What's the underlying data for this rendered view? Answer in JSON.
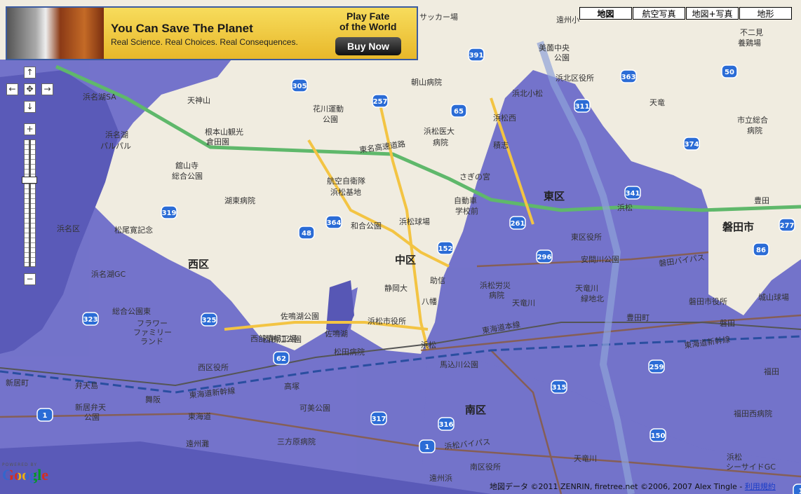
{
  "ad": {
    "headline": "You Can Save The Planet",
    "subline": "Real Science. Real Choices. Real Consequences.",
    "right_line1": "Play Fate",
    "right_line2": "of the World",
    "button": "Buy Now"
  },
  "map_types": [
    "地図",
    "航空写真",
    "地図+写真",
    "地形"
  ],
  "active_map_type": "地図",
  "controls": {
    "up": "↑",
    "down": "↓",
    "left": "←",
    "right": "→",
    "center": "✥",
    "zoom_in": "+",
    "zoom_out": "−"
  },
  "districts": [
    "西区",
    "中区",
    "東区",
    "南区",
    "磐田市"
  ],
  "places": [
    "天神山",
    "根本山観光",
    "倉田園",
    "舘山寺",
    "総合公園",
    "湖東病院",
    "浜名湖",
    "パルパル",
    "浜名区",
    "松尾寛記念",
    "浜名湖GC",
    "総合公園東",
    "フラワー",
    "ファミリー",
    "ランド",
    "西区役所",
    "西部清掃工場",
    "新居町",
    "弁天島",
    "新居弁天",
    "公園",
    "舞阪",
    "東海道",
    "可美公園",
    "三方原病院",
    "遠州灘",
    "佐鳴湖公園",
    "佐鳴湖",
    "西鴨江公園",
    "航空自衛隊",
    "浜松基地",
    "和合公園",
    "浜松球場",
    "花川運動",
    "公園",
    "朝山病院",
    "浜松医大",
    "病院",
    "自動車",
    "学校前",
    "静岡大",
    "浜松市役所",
    "浜松",
    "助信",
    "八幡",
    "松田病院",
    "高塚",
    "馬込川公園",
    "浜松労災",
    "病院",
    "天竜川",
    "安間川公園",
    "東区役所",
    "天竜川",
    "緑地北",
    "豊田町",
    "磐田",
    "磐田市役所",
    "城山球場",
    "浜北区役所",
    "浜北小松",
    "美薗中央",
    "公園",
    "天竜",
    "市立総合",
    "病院",
    "不二見",
    "養鶏場",
    "サッカー場",
    "遠州小",
    "浜松西",
    "さぎの宮",
    "積志",
    "浜松",
    "浜名湖SA",
    "南区",
    "南区役所",
    "遠州浜",
    "浜松",
    "シーサイドGC",
    "福田西病院",
    "福田",
    "東名高速道路",
    "東海道本線",
    "東海道新幹線",
    "磐田バイパス",
    "浜松バイパス",
    "東海道新幹線",
    "天竜川",
    "豊田",
    "聖隷浜松"
  ],
  "shields": [
    "305",
    "257",
    "391",
    "65",
    "363",
    "311",
    "374",
    "341",
    "319",
    "364",
    "48",
    "261",
    "296",
    "152",
    "62",
    "323",
    "325",
    "1",
    "317",
    "316",
    "315",
    "259",
    "150",
    "1",
    "277",
    "86",
    "1",
    "50"
  ],
  "copyright_text": "地図データ ©2011 ZENRIN, firetree.net ©2006, 2007 Alex Tingle - ",
  "terms_link": "利用規約",
  "google_powered": "POWERED BY",
  "google_logo": "Google"
}
